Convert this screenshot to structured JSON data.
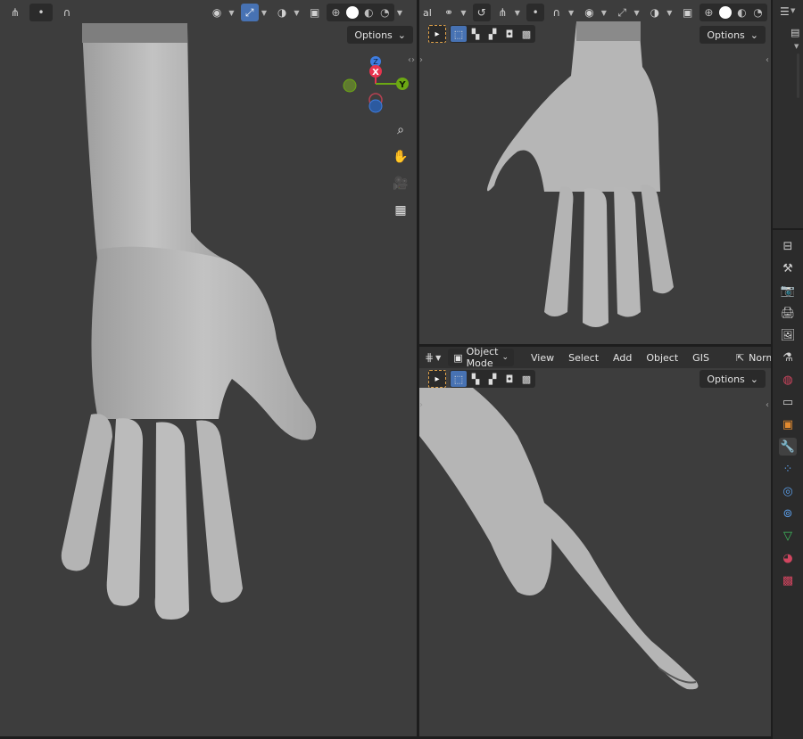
{
  "left_viewport": {
    "options_label": "Options"
  },
  "top_right_viewport": {
    "header_cut_label": "al",
    "options_label": "Options"
  },
  "bottom_right_viewport": {
    "menu": {
      "mode_label": "Object Mode",
      "items": [
        "View",
        "Select",
        "Add",
        "Object",
        "GIS"
      ],
      "transform_label": "Norm"
    },
    "options_label": "Options"
  },
  "gizmo": {
    "x_label": "X",
    "y_label": "Y",
    "z_label": "Z"
  },
  "colors": {
    "viewport_bg": "#3d3d3d",
    "accent_blue": "#4772b3",
    "axis_x": "#e8344e",
    "axis_y": "#6ca813",
    "axis_z": "#3e7de0",
    "mesh": "#b9b9b9"
  }
}
